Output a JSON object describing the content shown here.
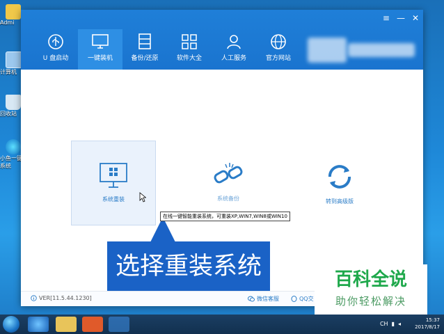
{
  "desktop": {
    "icons": [
      {
        "label": "Admi",
        "icon": "folder-icon"
      },
      {
        "label": "计算机",
        "icon": "computer-icon"
      },
      {
        "label": "回收站",
        "icon": "recycle-bin-icon"
      },
      {
        "label": "小鱼一键",
        "icon": "app-icon"
      },
      {
        "label": "系统",
        "icon": "app-icon"
      }
    ]
  },
  "window": {
    "controls": {
      "menu": "≡",
      "minimize": "—",
      "close": "✕"
    },
    "nav": [
      {
        "label": "U 盘启动",
        "icon": "usb-icon"
      },
      {
        "label": "一键装机",
        "icon": "monitor-icon"
      },
      {
        "label": "备份/还原",
        "icon": "backup-icon"
      },
      {
        "label": "软件大全",
        "icon": "apps-grid-icon"
      },
      {
        "label": "人工服务",
        "icon": "person-icon"
      },
      {
        "label": "官方网站",
        "icon": "globe-icon"
      }
    ],
    "options": {
      "system": {
        "label": "系统重装",
        "icon": "windows-monitor-icon"
      },
      "backup": {
        "label": "系统备份",
        "icon": "broken-link-icon"
      },
      "switch": {
        "label": "转到高级版",
        "icon": "refresh-icon"
      }
    },
    "tooltip": "在线一键智能重装系统，可重装XP,WIN7,WIN8或WIN10",
    "callout": "选择重装系统",
    "footer": {
      "version": "VER[11.5.44.1230]",
      "wechat": "微信客服",
      "qq": "QQ交"
    }
  },
  "watermark": {
    "title": "百科全说",
    "subtitle": "助你轻松解决"
  },
  "taskbar": {
    "tray_text": "CH",
    "time": "15:37",
    "date": "2017/8/17"
  },
  "colors": {
    "header_blue": "#1a74cf",
    "callout_blue": "#1a62c6",
    "accent": "#2a7cc7",
    "watermark_green": "#1ea84b"
  }
}
